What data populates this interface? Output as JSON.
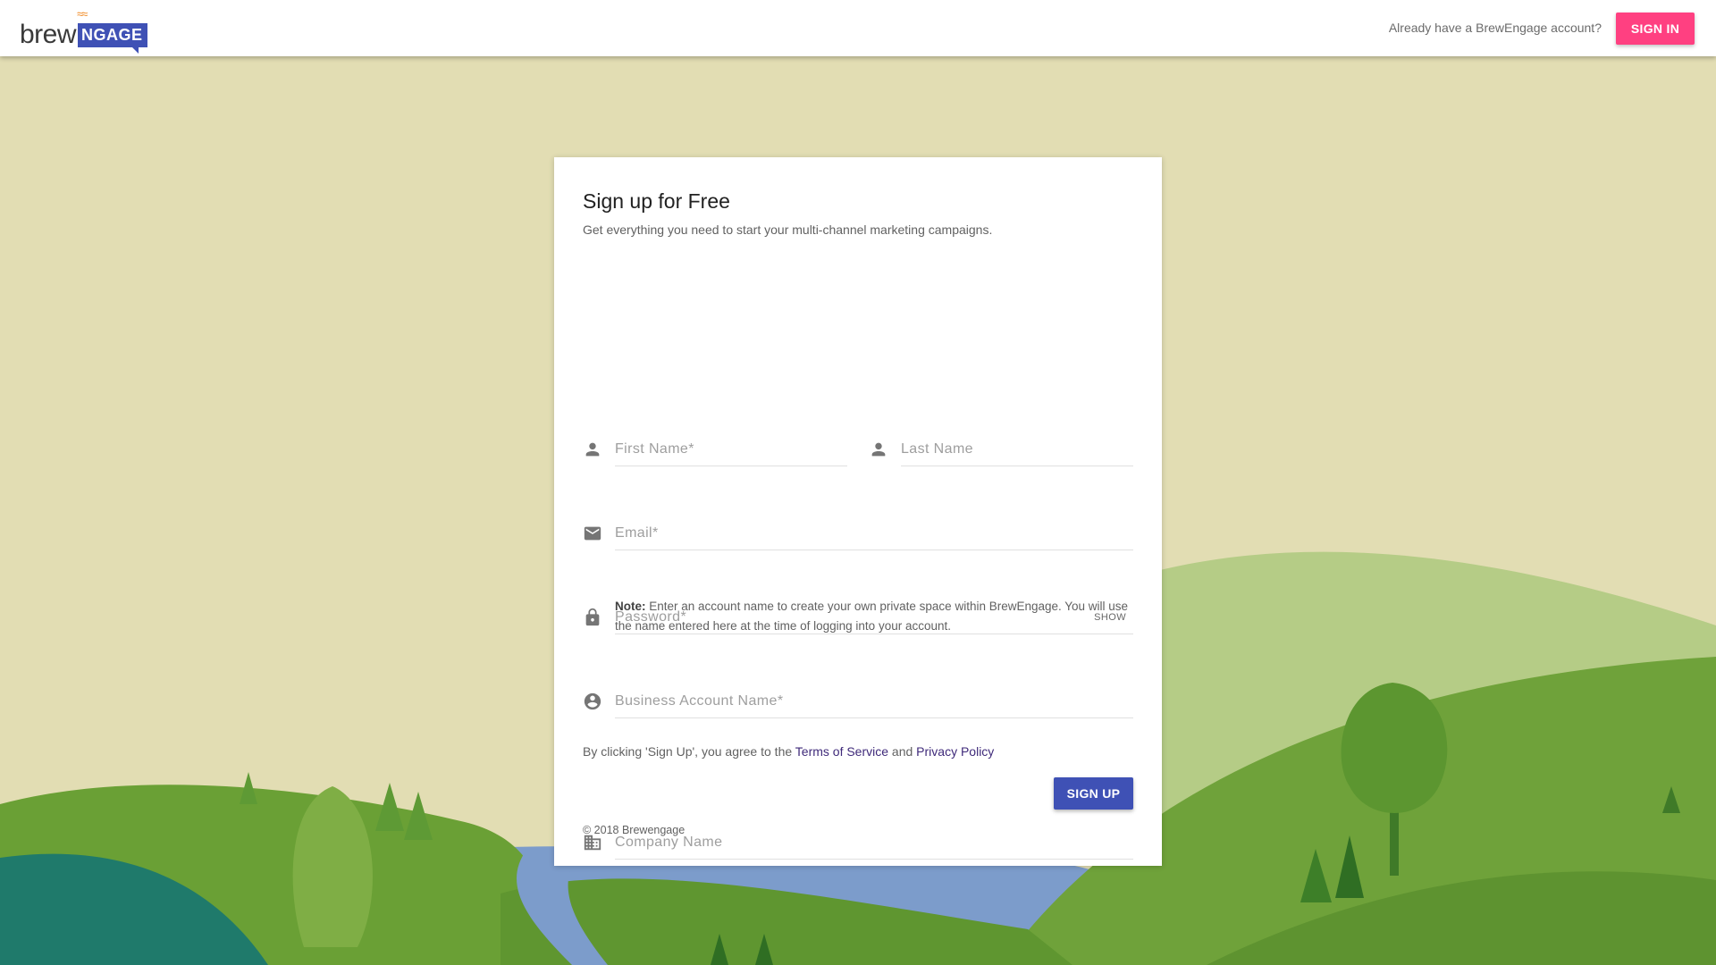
{
  "header": {
    "logo_text_brew": "brew",
    "logo_text_ngage": "NGAGE",
    "account_question": "Already have a BrewEngage account?",
    "signin_label": "SIGN IN"
  },
  "form": {
    "title": "Sign up for Free",
    "subtitle": "Get everything you need to start your multi-channel marketing campaigns.",
    "first_name_placeholder": "First Name*",
    "last_name_placeholder": "Last Name",
    "email_placeholder": "Email*",
    "password_placeholder": "Password*",
    "password_toggle_label": "SHOW",
    "business_account_placeholder": "Business Account Name*",
    "note_label": "Note:",
    "note_text": " Enter an account name to create your own private space within BrewEngage. You will use the name entered here at the time of logging into your account.",
    "company_placeholder": "Company Name",
    "terms_prefix": "By clicking 'Sign Up', you agree to the ",
    "terms_link": "Terms of Service",
    "terms_and": " and ",
    "privacy_link": "Privacy Policy",
    "signup_label": "SIGN UP",
    "copyright": "© 2018 Brewengage"
  },
  "colors": {
    "accent_pink": "#ff4081",
    "primary_indigo": "#3f51b5",
    "background_sand": "#e2ddb3"
  },
  "icons": [
    "person-icon",
    "email-icon",
    "lock-icon",
    "account-circle-icon",
    "business-icon"
  ]
}
